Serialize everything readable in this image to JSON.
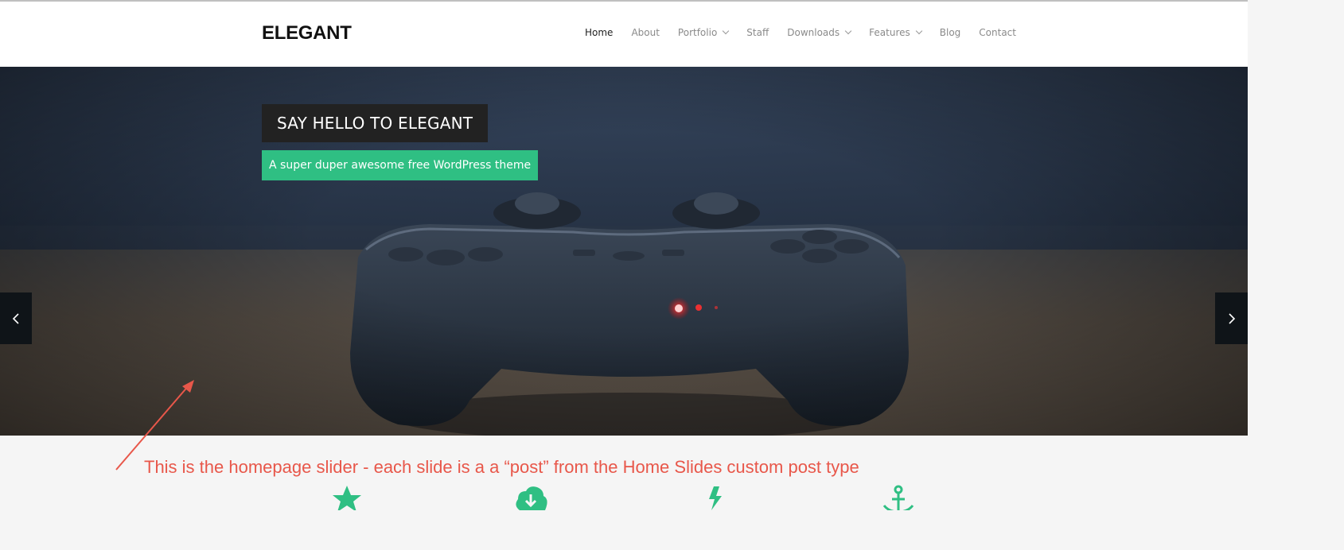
{
  "site": {
    "logo": "ELEGANT"
  },
  "nav": {
    "items": [
      {
        "label": "Home",
        "active": true,
        "has_dropdown": false
      },
      {
        "label": "About",
        "active": false,
        "has_dropdown": false
      },
      {
        "label": "Portfolio",
        "active": false,
        "has_dropdown": true
      },
      {
        "label": "Staff",
        "active": false,
        "has_dropdown": false
      },
      {
        "label": "Downloads",
        "active": false,
        "has_dropdown": true
      },
      {
        "label": "Features",
        "active": false,
        "has_dropdown": true
      },
      {
        "label": "Blog",
        "active": false,
        "has_dropdown": false
      },
      {
        "label": "Contact",
        "active": false,
        "has_dropdown": false
      }
    ]
  },
  "slider": {
    "title": "SAY HELLO TO ELEGANT",
    "subtitle": "A super duper awesome free WordPress theme",
    "prev_icon": "chevron-left-icon",
    "next_icon": "chevron-right-icon"
  },
  "annotation": {
    "text": "This is the homepage slider - each slide is a a “post” from the Home Slides custom post type"
  },
  "features": {
    "icons": [
      "star-icon",
      "cloud-download-icon",
      "bolt-icon",
      "anchor-icon"
    ]
  },
  "colors": {
    "accent": "#2fbf83",
    "annotation": "#e8574a",
    "title_bg": "#222222"
  }
}
